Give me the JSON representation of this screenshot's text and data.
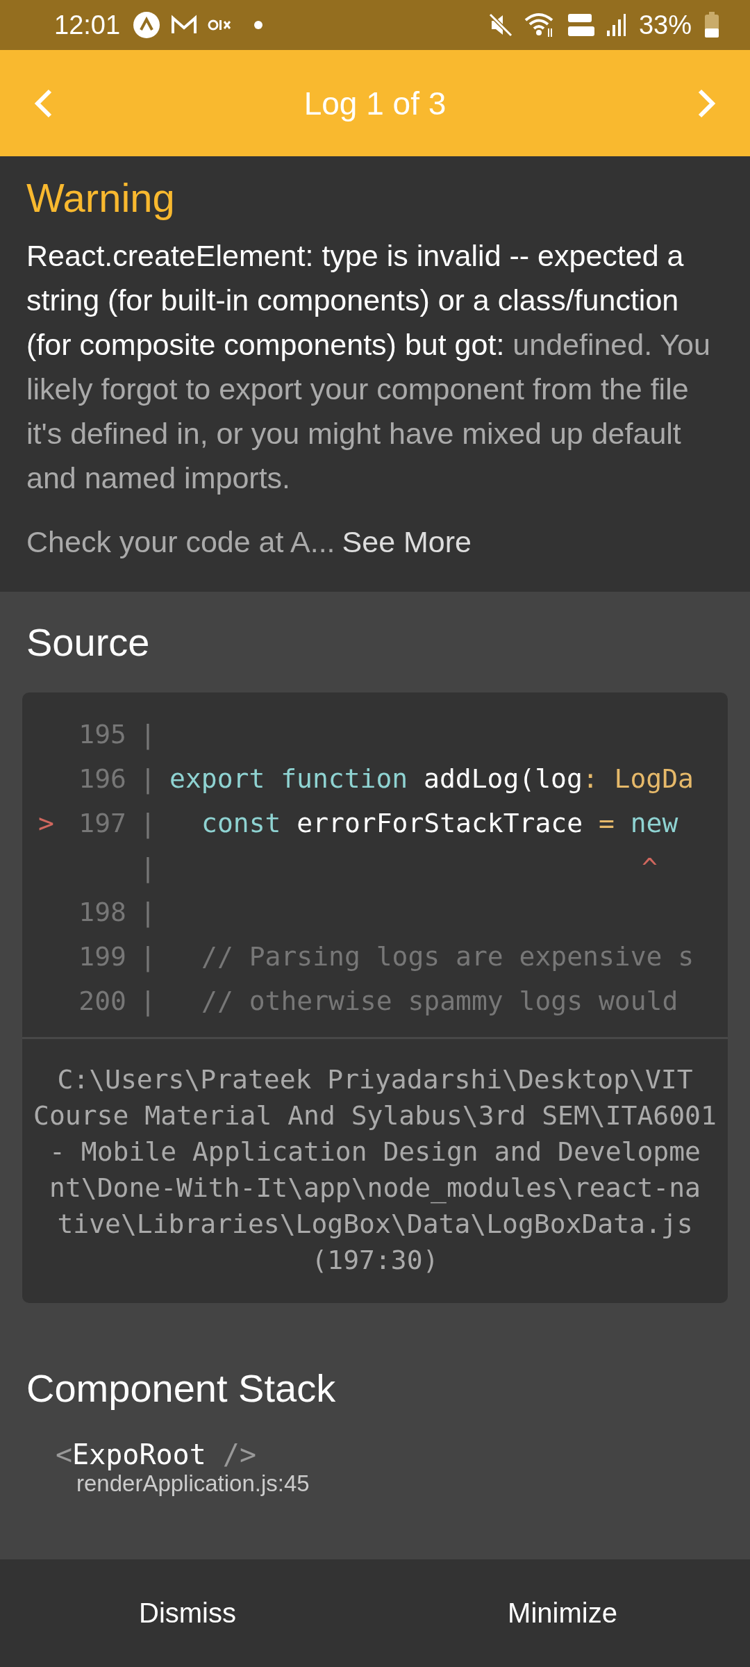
{
  "status_bar": {
    "time": "12:01",
    "battery": "33%"
  },
  "header": {
    "title": "Log 1 of 3"
  },
  "warning": {
    "level": "Warning",
    "message_primary": "React.createElement: type is invalid -- expected a string (for built-in components) or a class/function (for composite components) but got:",
    "message_secondary": "undefined. You likely forgot to export your component from the file it's defined in, or you might have mixed up default and named imports.",
    "check_text": "Check your code at A...",
    "see_more": "See More"
  },
  "source": {
    "title": "Source",
    "lines": [
      {
        "kind": "code",
        "number": "195",
        "gutter": "|"
      },
      {
        "kind": "code",
        "number": "196",
        "gutter": "|",
        "indented": false,
        "tokens": [
          {
            "kind": "keyword",
            "text": "export function"
          },
          {
            "kind": "plain",
            "text": " addLog(log"
          },
          {
            "kind": "type",
            "text": ": LogDa"
          }
        ]
      },
      {
        "kind": "code",
        "number": "197",
        "gutter": "|",
        "pointer": ">",
        "indented": true,
        "tokens": [
          {
            "kind": "keyword",
            "text": "const"
          },
          {
            "kind": "plain",
            "text": " errorForStackTrace "
          },
          {
            "kind": "type",
            "text": "="
          },
          {
            "kind": "keyword",
            "text": " new"
          }
        ]
      },
      {
        "kind": "caret",
        "gutter": "|",
        "caret": "^"
      },
      {
        "kind": "code",
        "number": "198",
        "gutter": "|"
      },
      {
        "kind": "code",
        "number": "199",
        "gutter": "|",
        "indented": true,
        "tokens": [
          {
            "kind": "comment",
            "text": "// Parsing logs are expensive s"
          }
        ]
      },
      {
        "kind": "code",
        "number": "200",
        "gutter": "|",
        "indented": true,
        "tokens": [
          {
            "kind": "comment",
            "text": "// otherwise spammy logs would"
          }
        ]
      }
    ],
    "file_path": [
      "C:\\Users\\Prateek Priyadarshi\\Desktop\\VIT",
      "Course Material And Sylabus\\3rd SEM\\ITA6001",
      "- Mobile Application Design and Developme",
      "nt\\Done-With-It\\app\\node_modules\\react-na",
      "tive\\Libraries\\LogBox\\Data\\LogBoxData.js",
      "(197:30)"
    ]
  },
  "component_stack": {
    "title": "Component Stack",
    "items": [
      {
        "open": "<",
        "name": "ExpoRoot",
        "close": " />",
        "location": "renderApplication.js:45"
      }
    ]
  },
  "footer": {
    "buttons": [
      "Dismiss",
      "Minimize"
    ]
  }
}
